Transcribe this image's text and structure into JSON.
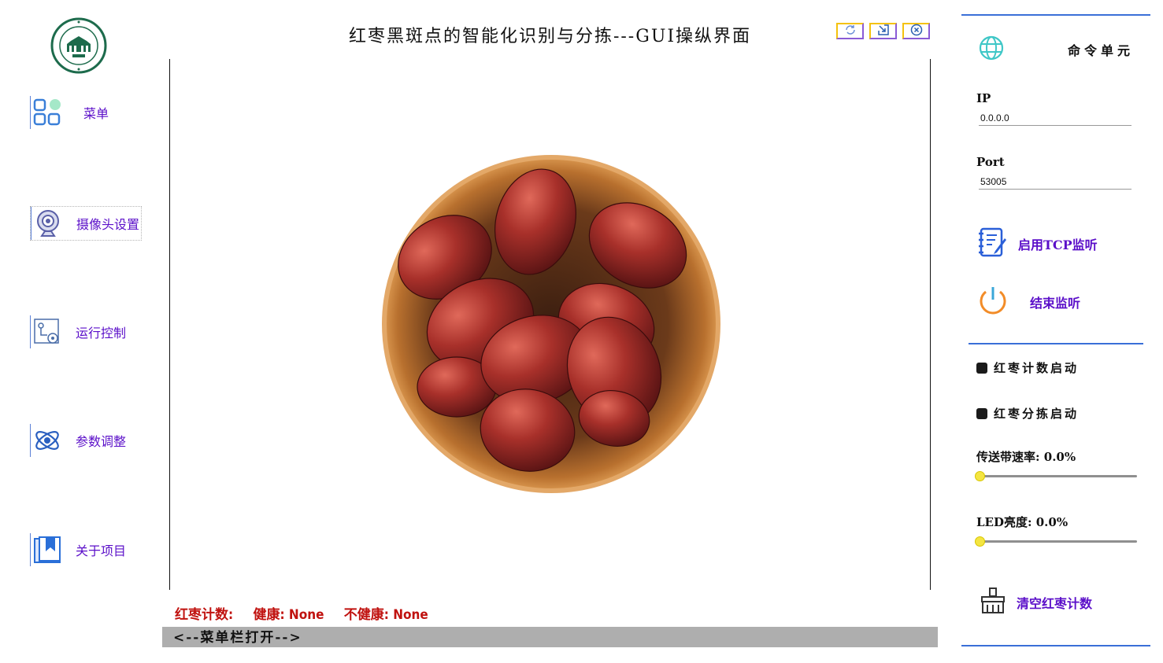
{
  "header": {
    "title": "红枣黑斑点的智能化识别与分拣---GUI操纵界面"
  },
  "window_controls": [
    {
      "icon": "refresh-icon"
    },
    {
      "icon": "maximize-icon"
    },
    {
      "icon": "close-icon"
    }
  ],
  "sidebar": {
    "logo": "university-seal-logo",
    "items": [
      {
        "label": "菜单",
        "icon": "grid-menu-icon"
      },
      {
        "label": "摄像头设置",
        "icon": "webcam-icon",
        "selected": true
      },
      {
        "label": "运行控制",
        "icon": "flow-control-icon"
      },
      {
        "label": "参数调整",
        "icon": "atom-icon"
      },
      {
        "label": "关于项目",
        "icon": "bookmark-icon"
      }
    ]
  },
  "main": {
    "image": "red-jujube-bowl-photo"
  },
  "status": {
    "count_label": "红枣计数:",
    "healthy_label": "健康: None",
    "unhealthy_label": "不健康: None"
  },
  "menu_bar": {
    "label": "<--菜单栏打开-->"
  },
  "command_panel": {
    "title": "命令单元",
    "icon": "globe-icon",
    "ip_label": "IP",
    "ip_value": "0.0.0.0",
    "port_label": "Port",
    "port_value": "53005",
    "start_tcp_label": "启用TCP监听",
    "stop_label": "结束监听",
    "count_toggle_label": "红枣计数启动",
    "sort_toggle_label": "红枣分拣启动",
    "conveyor_speed_label": "传送带速率: 0.0%",
    "conveyor_speed_value": 0.0,
    "led_brightness_label": "LED亮度: 0.0%",
    "led_brightness_value": 0.0,
    "clear_count_label": "清空红枣计数"
  },
  "colors": {
    "accent": "#5b0fc9",
    "status_red": "#c0120f",
    "divider_blue": "#3a6fd8",
    "menu_bar_gray": "#aeaeae",
    "slider_thumb": "#f4e542"
  }
}
